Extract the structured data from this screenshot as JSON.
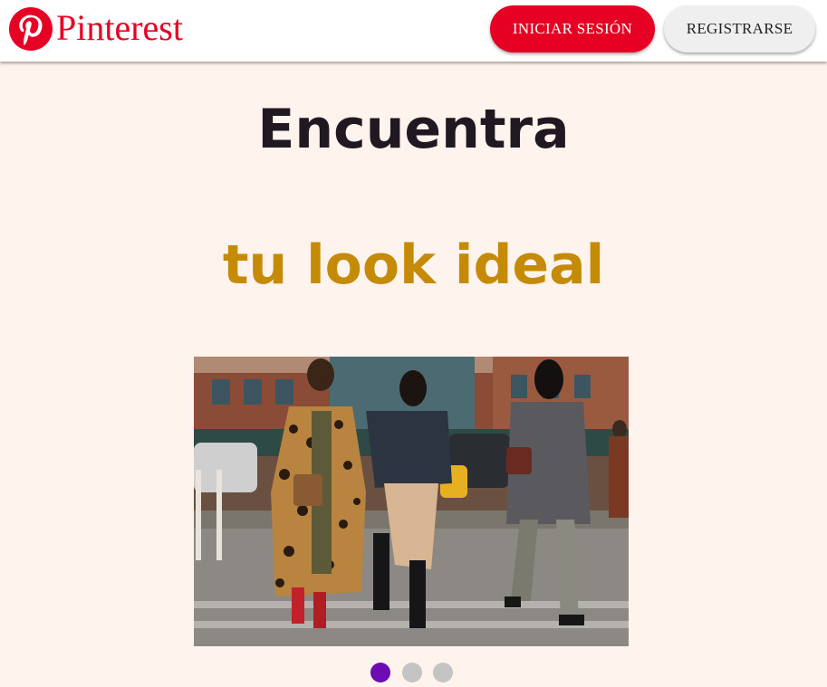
{
  "header": {
    "brand": "Pinterest",
    "logo_icon": "pinterest-logo-icon",
    "login_label": "INICIAR SESIÓN",
    "register_label": "REGISTRARSE"
  },
  "hero": {
    "line1": "Encuentra",
    "line2": "tu look ideal",
    "image": "street-style-photo"
  },
  "carousel": {
    "dots": [
      {
        "active": true,
        "color": "#6c0db3"
      },
      {
        "active": false,
        "color": "#c4c4c4"
      },
      {
        "active": false,
        "color": "#c4c4c4"
      }
    ]
  },
  "colors": {
    "brand_red": "#e60023",
    "background": "#fff3ee",
    "headline_dark": "#211922",
    "headline_accent": "#c58a06",
    "dot_active": "#6c0db3",
    "dot_inactive": "#c4c4c4"
  }
}
